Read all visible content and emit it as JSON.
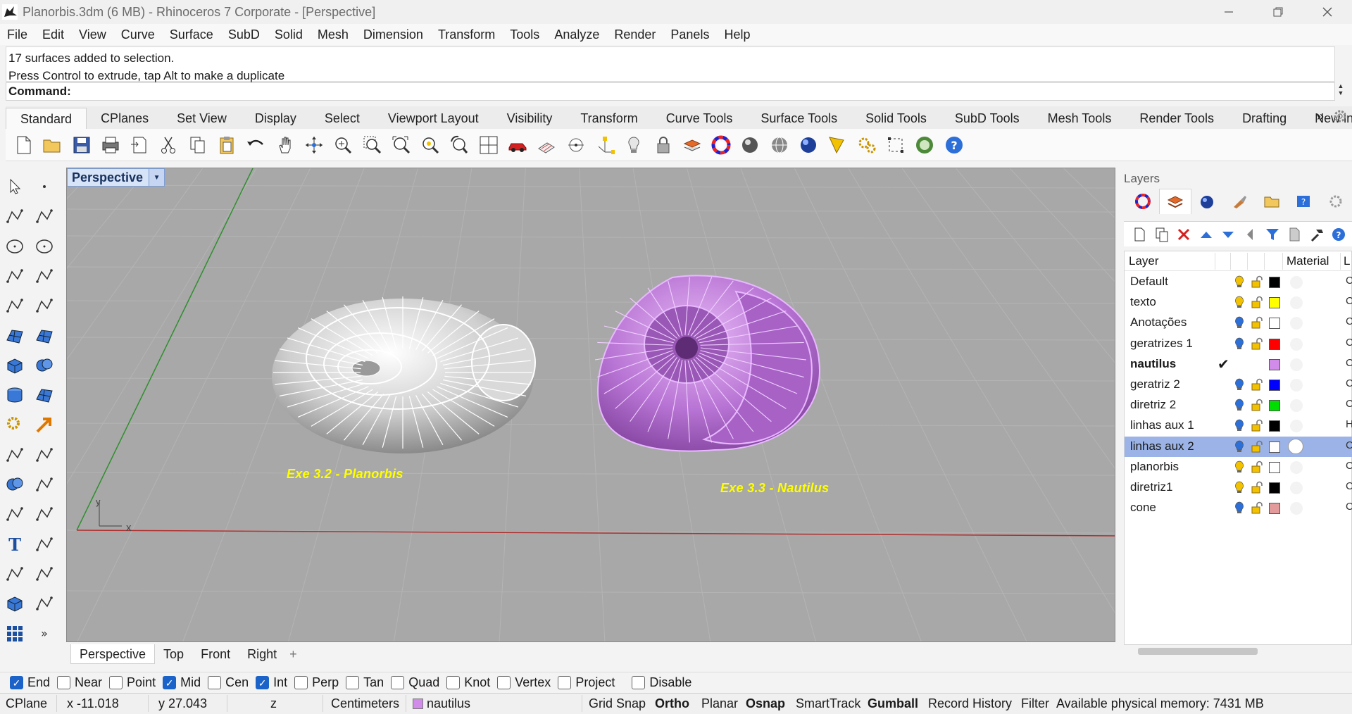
{
  "window": {
    "title": "Planorbis.3dm (6 MB) - Rhinoceros 7 Corporate - [Perspective]",
    "controls": [
      "minimize",
      "restore",
      "close"
    ]
  },
  "menu": [
    "File",
    "Edit",
    "View",
    "Curve",
    "Surface",
    "SubD",
    "Solid",
    "Mesh",
    "Dimension",
    "Transform",
    "Tools",
    "Analyze",
    "Render",
    "Panels",
    "Help"
  ],
  "command": {
    "history": [
      "17 surfaces added to selection.",
      "Press Control to extrude, tap Alt to make a duplicate"
    ],
    "prompt": "Command:",
    "value": ""
  },
  "toolbar_tabs": {
    "items": [
      "Standard",
      "CPlanes",
      "Set View",
      "Display",
      "Select",
      "Viewport Layout",
      "Visibility",
      "Transform",
      "Curve Tools",
      "Surface Tools",
      "Solid Tools",
      "SubD Tools",
      "Mesh Tools",
      "Render Tools",
      "Drafting",
      "New in"
    ],
    "active": "Standard",
    "overflow": "»"
  },
  "toolbar_icons": [
    "new-file-icon",
    "open-file-icon",
    "save-icon",
    "print-icon",
    "import-icon",
    "cut-icon",
    "copy-icon",
    "paste-icon",
    "undo-icon",
    "pan-hand-icon",
    "rotate-view-icon",
    "zoom-icon",
    "zoom-window-icon",
    "zoom-extents-icon",
    "zoom-selected-icon",
    "undo-view-icon",
    "four-viewports-icon",
    "car-icon",
    "cplane-icon",
    "point-object-snap-icon",
    "gumball-icon",
    "light-bulb-icon",
    "lock-icon",
    "layers-icon",
    "color-wheel-icon",
    "shaded-sphere-icon",
    "wire-sphere-icon",
    "render-sphere-icon",
    "dimension-icon",
    "settings-gears-icon",
    "grid-points-icon",
    "globe-icon",
    "help-icon"
  ],
  "viewport": {
    "name": "Perspective",
    "labels": [
      "Exe 3.2 - Planorbis",
      "Exe 3.3 - Nautilus"
    ],
    "axis_x": "x",
    "axis_y": "y"
  },
  "viewport_tabs": {
    "items": [
      "Perspective",
      "Top",
      "Front",
      "Right"
    ],
    "active": "Perspective",
    "add": "+"
  },
  "layers_panel": {
    "title": "Layers",
    "columns": {
      "name": "Layer",
      "material": "Material",
      "more": "L"
    },
    "tabs": [
      "color-wheel-icon",
      "layers-icon",
      "render-icon",
      "brush-icon",
      "folder-icon",
      "help-page-icon",
      "gear-icon"
    ],
    "tools": [
      "new-layer-icon",
      "new-sublayer-icon",
      "delete-layer-icon",
      "move-up-icon",
      "move-down-icon",
      "move-left-icon",
      "filter-icon",
      "page-icon",
      "hammer-icon",
      "help-icon"
    ],
    "rows": [
      {
        "name": "Default",
        "bulb": "#f2c200",
        "color": "#000000",
        "tail": "C",
        "current": false,
        "selected": false
      },
      {
        "name": "texto",
        "bulb": "#f2c200",
        "color": "#ffff00",
        "tail": "C",
        "current": false,
        "selected": false
      },
      {
        "name": "Anotações",
        "bulb": "#2c6fd8",
        "color": "#ffffff",
        "tail": "C",
        "current": false,
        "selected": false
      },
      {
        "name": "geratrizes 1",
        "bulb": "#2c6fd8",
        "color": "#ff0000",
        "tail": "C",
        "current": false,
        "selected": false
      },
      {
        "name": "nautilus",
        "bulb": "",
        "color": "#d08ce8",
        "tail": "C",
        "current": true,
        "selected": false,
        "check": "✔"
      },
      {
        "name": "geratriz 2",
        "bulb": "#2c6fd8",
        "color": "#0000ff",
        "tail": "C",
        "current": false,
        "selected": false
      },
      {
        "name": "diretriz 2",
        "bulb": "#2c6fd8",
        "color": "#00dd00",
        "tail": "C",
        "current": false,
        "selected": false
      },
      {
        "name": "linhas aux 1",
        "bulb": "#2c6fd8",
        "color": "#000000",
        "tail": "H",
        "current": false,
        "selected": false
      },
      {
        "name": "linhas aux 2",
        "bulb": "#2c6fd8",
        "color": "#ffffff",
        "tail": "C",
        "current": false,
        "selected": true
      },
      {
        "name": "planorbis",
        "bulb": "#f2c200",
        "color": "#ffffff",
        "tail": "C",
        "current": false,
        "selected": false
      },
      {
        "name": "diretriz1",
        "bulb": "#f2c200",
        "color": "#000000",
        "tail": "C",
        "current": false,
        "selected": false
      },
      {
        "name": "cone",
        "bulb": "#2c6fd8",
        "color": "#e29a9a",
        "tail": "C",
        "current": false,
        "selected": false
      }
    ]
  },
  "osnaps": [
    {
      "label": "End",
      "checked": true
    },
    {
      "label": "Near",
      "checked": false
    },
    {
      "label": "Point",
      "checked": false
    },
    {
      "label": "Mid",
      "checked": true
    },
    {
      "label": "Cen",
      "checked": false
    },
    {
      "label": "Int",
      "checked": true
    },
    {
      "label": "Perp",
      "checked": false
    },
    {
      "label": "Tan",
      "checked": false
    },
    {
      "label": "Quad",
      "checked": false
    },
    {
      "label": "Knot",
      "checked": false
    },
    {
      "label": "Vertex",
      "checked": false
    },
    {
      "label": "Project",
      "checked": false
    },
    {
      "label": "Disable",
      "checked": false
    }
  ],
  "status": {
    "cplane": "CPlane",
    "x": "x -11.018",
    "y": "y 27.043",
    "z": "z",
    "units": "Centimeters",
    "layer": "nautilus",
    "layer_color": "#d08ce8",
    "grid_snap": "Grid Snap",
    "ortho": "Ortho",
    "planar": "Planar",
    "osnap": "Osnap",
    "smarttrack": "SmartTrack",
    "gumball": "Gumball",
    "record_history": "Record History",
    "filter": "Filter",
    "memory": "Available physical memory: 7431 MB"
  },
  "colors": {
    "viewport_bg": "#a8a8a8",
    "grid": "#b4b4b4",
    "x_axis": "#b03030",
    "y_axis": "#2f8f2f",
    "nautilus": "#c48ce0",
    "label": "#ffff00",
    "selection": "#9bb3e6",
    "viewport_label_bg": "#d7e3f7"
  }
}
